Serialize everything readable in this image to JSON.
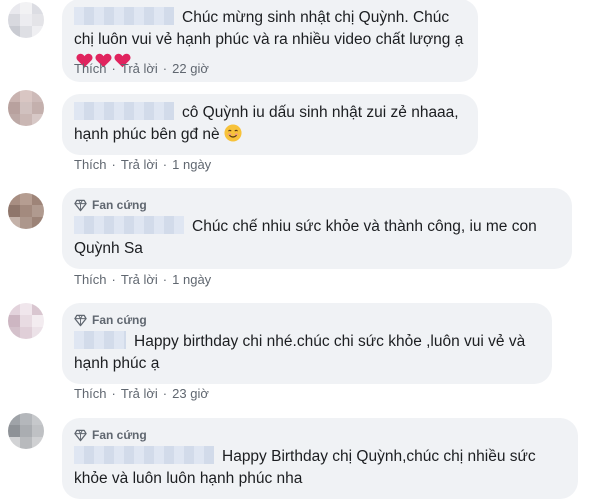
{
  "comments": [
    {
      "badge": "",
      "text": "Chúc mừng sinh nhật chị Quỳnh. Chúc chị luôn vui vẻ hạnh phúc và ra nhiều video chất lượng ạ",
      "like": "Thích",
      "reply": "Trả lời",
      "time": "22 giờ"
    },
    {
      "badge": "",
      "text": "cô Quỳnh iu dấu sinh nhật zui zẻ nhaaa, hạnh phúc bên gđ nè",
      "like": "Thích",
      "reply": "Trả lời",
      "time": "1 ngày"
    },
    {
      "badge": "Fan cứng",
      "text": "Chúc chế nhiu sức khỏe và thành công, iu me con Quỳnh Sa",
      "like": "Thích",
      "reply": "Trả lời",
      "time": "1 ngày"
    },
    {
      "badge": "Fan cứng",
      "text": "Happy birthday chi nhé.chúc chi sức khỏe ,luôn vui vẻ và hạnh phúc ạ",
      "like": "Thích",
      "reply": "Trả lời",
      "time": "23 giờ"
    },
    {
      "badge": "Fan cứng",
      "text": "Happy Birthday chị Quỳnh,chúc chị nhiều sức khỏe và luôn luôn hạnh phúc nha",
      "like": "",
      "reply": "",
      "time": ""
    }
  ],
  "separator": "·",
  "icons": {
    "badge": "diamond-icon",
    "heart": "red-heart-icon",
    "smile": "smiling-face-icon"
  },
  "colors": {
    "bubble": "#f0f2f5",
    "heart": "#e0245e",
    "meta": "#606770"
  }
}
